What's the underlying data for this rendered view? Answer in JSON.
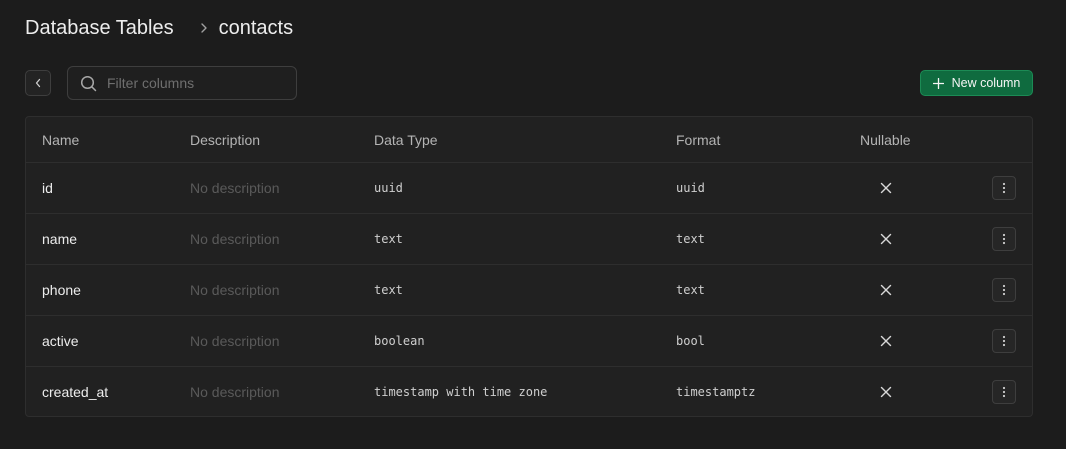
{
  "breadcrumb": {
    "root": "Database Tables",
    "separator_icon": "chevron-right-icon",
    "current": "contacts"
  },
  "toolbar": {
    "back_icon": "chevron-left-icon",
    "search": {
      "icon": "search-icon",
      "placeholder": "Filter columns",
      "value": ""
    },
    "new_column": {
      "icon": "plus-icon",
      "label": "New column",
      "color": "#0f6b3f"
    }
  },
  "table": {
    "headers": {
      "name": "Name",
      "description": "Description",
      "data_type": "Data Type",
      "format": "Format",
      "nullable": "Nullable"
    },
    "rows": [
      {
        "name": "id",
        "description": "No description",
        "data_type": "uuid",
        "format": "uuid",
        "nullable_icon": "x-icon"
      },
      {
        "name": "name",
        "description": "No description",
        "data_type": "text",
        "format": "text",
        "nullable_icon": "x-icon"
      },
      {
        "name": "phone",
        "description": "No description",
        "data_type": "text",
        "format": "text",
        "nullable_icon": "x-icon"
      },
      {
        "name": "active",
        "description": "No description",
        "data_type": "boolean",
        "format": "bool",
        "nullable_icon": "x-icon"
      },
      {
        "name": "created_at",
        "description": "No description",
        "data_type": "timestamp with time zone",
        "format": "timestamptz",
        "nullable_icon": "x-icon"
      }
    ]
  }
}
